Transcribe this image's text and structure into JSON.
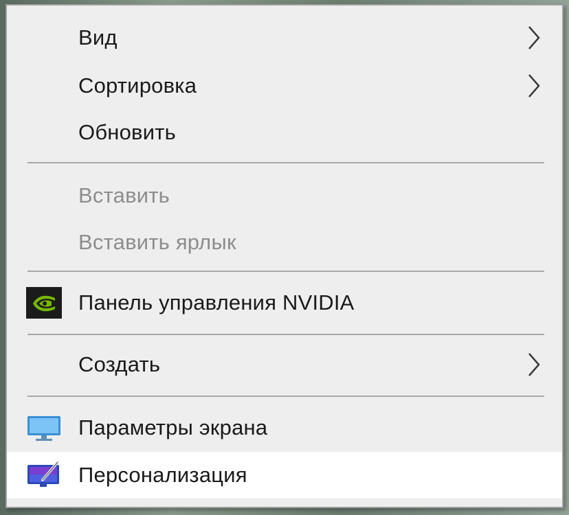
{
  "context_menu": {
    "items": [
      {
        "label": "Вид",
        "enabled": true,
        "has_submenu": true
      },
      {
        "label": "Сортировка",
        "enabled": true,
        "has_submenu": true
      },
      {
        "label": "Обновить",
        "enabled": true,
        "has_submenu": false
      },
      {
        "label": "Вставить",
        "enabled": false,
        "has_submenu": false
      },
      {
        "label": "Вставить ярлык",
        "enabled": false,
        "has_submenu": false
      },
      {
        "label": "Панель управления NVIDIA",
        "enabled": true,
        "has_submenu": false,
        "icon": "nvidia-icon"
      },
      {
        "label": "Создать",
        "enabled": true,
        "has_submenu": true
      },
      {
        "label": "Параметры экрана",
        "enabled": true,
        "has_submenu": false,
        "icon": "display-settings-icon"
      },
      {
        "label": "Персонализация",
        "enabled": true,
        "has_submenu": false,
        "icon": "personalization-icon",
        "highlighted": true
      }
    ]
  },
  "colors": {
    "menu_background": "#eeeeee",
    "highlight_background": "#ffffff",
    "text_enabled": "#1a1a1a",
    "text_disabled": "#8d8d8d",
    "separator": "#a8a8a8",
    "nvidia_green": "#76b900"
  }
}
